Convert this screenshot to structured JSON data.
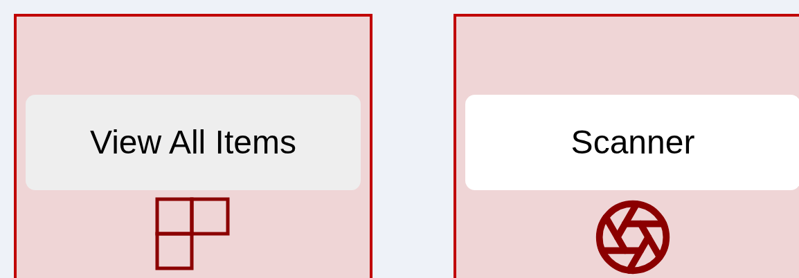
{
  "tiles": [
    {
      "label": "View All Items",
      "kind": "grid",
      "highlighted": true
    },
    {
      "label": "Scanner",
      "kind": "aperture",
      "highlighted": false
    }
  ]
}
